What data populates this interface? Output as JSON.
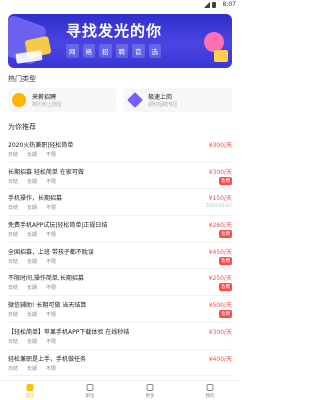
{
  "status_bar": {
    "time": "8:07"
  },
  "banner": {
    "title": "寻找发光的你",
    "tags": [
      "网",
      "络",
      "招",
      "聘",
      "首",
      "选"
    ]
  },
  "hot_types": {
    "section_title": "热门类型",
    "items": [
      {
        "name": "来薪招聘",
        "subtitle": "简历秒上岗位",
        "icon": "coin-icon",
        "color": "#ffb400"
      },
      {
        "name": "极速上岗",
        "subtitle": "即时招聘专区",
        "icon": "diamond-icon",
        "color": "#7a5cff"
      }
    ]
  },
  "recommend": {
    "section_title": "为你推荐",
    "jobs": [
      {
        "title": "2020火热兼职|轻松简单",
        "salary": "¥300/天",
        "meta": [
          "日结",
          "长期",
          "不限"
        ],
        "badge": "",
        "date": ""
      },
      {
        "title": "长期招募  轻松简单 在家可做",
        "salary": "¥300/天",
        "meta": [
          "日结",
          "长期",
          "不限"
        ],
        "badge": "急聘",
        "date": ""
      },
      {
        "title": "手机操作，长期招募",
        "salary": "¥150/天",
        "meta": [
          "日结",
          "长期",
          "不限"
        ],
        "badge": "",
        "date": "2020-05-07"
      },
      {
        "title": "免费手机APP试玩|轻松简单|正规日结",
        "salary": "¥260/天",
        "meta": [
          "日结",
          "长期",
          "不限"
        ],
        "badge": "急聘",
        "date": ""
      },
      {
        "title": "全国招募，上班 带孩子都不耽误",
        "salary": "¥450/天",
        "meta": [
          "日结",
          "长期",
          "不限"
        ],
        "badge": "急聘",
        "date": ""
      },
      {
        "title": "不限时间,操作简单,长期招募",
        "salary": "¥250/天",
        "meta": [
          "日结",
          "长期",
          "不限"
        ],
        "badge": "急聘",
        "date": ""
      },
      {
        "title": "微信辅助! 长期可做 当天结算",
        "salary": "¥500/天",
        "meta": [
          "日结",
          "长期",
          "不限"
        ],
        "badge": "急聘",
        "date": ""
      },
      {
        "title": "【轻松简单】苹果手机APP下载体验 在线秒结",
        "salary": "¥300/天",
        "meta": [
          "日结",
          "长期",
          "不限"
        ],
        "badge": "",
        "date": ""
      },
      {
        "title": "轻松兼职是上手，手机做任务",
        "salary": "¥400/天",
        "meta": [
          "日结",
          "长期",
          "不限"
        ],
        "badge": "",
        "date": ""
      }
    ]
  },
  "tab_bar": {
    "items": [
      {
        "label": "首页",
        "icon": "home-icon",
        "active": true
      },
      {
        "label": "职位",
        "icon": "briefcase-icon",
        "active": false
      },
      {
        "label": "更多",
        "icon": "grid-icon",
        "active": false
      },
      {
        "label": "我的",
        "icon": "user-icon",
        "active": false
      }
    ]
  }
}
